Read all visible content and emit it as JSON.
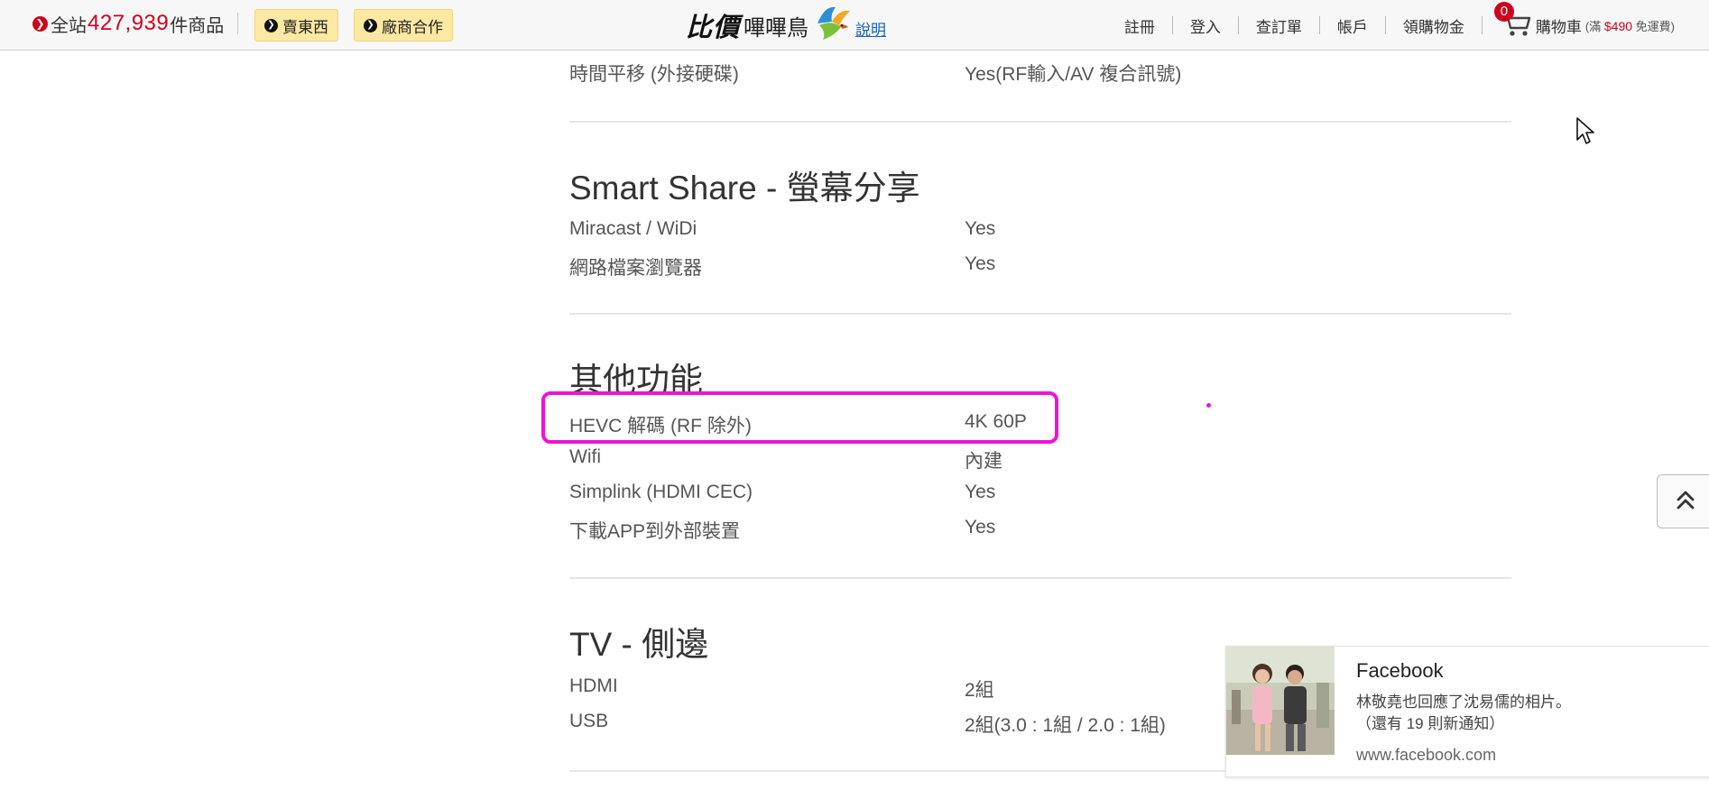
{
  "topbar": {
    "count_prefix": "全站",
    "count_number": "427,939",
    "count_suffix": "件商品",
    "sell_label": "賣東西",
    "partner_label": "廠商合作",
    "logo_main": "比價",
    "logo_sub": "嗶嗶鳥",
    "logo_help": "說明",
    "nav": [
      "註冊",
      "登入",
      "查訂單",
      "帳戶",
      "領購物金"
    ],
    "cart_count": "0",
    "cart_label": "購物車",
    "cart_note_prefix": "(滿",
    "cart_note_price": "$490",
    "cart_note_suffix": "免運費)"
  },
  "specs": {
    "top_row": {
      "key": "時間平移 (外接硬碟)",
      "value": "Yes(RF輸入/AV 複合訊號)"
    },
    "sections": [
      {
        "title": "Smart Share - 螢幕分享",
        "rows": [
          {
            "key": "Miracast / WiDi",
            "value": "Yes"
          },
          {
            "key": "網路檔案瀏覽器",
            "value": "Yes"
          }
        ]
      },
      {
        "title": "其他功能",
        "rows": [
          {
            "key": "HEVC 解碼 (RF 除外)",
            "value": "4K 60P"
          },
          {
            "key": "Wifi",
            "value": "內建"
          },
          {
            "key": "Simplink (HDMI CEC)",
            "value": "Yes"
          },
          {
            "key": "下載APP到外部裝置",
            "value": "Yes"
          }
        ]
      },
      {
        "title": "TV - 側邊",
        "rows": [
          {
            "key": "HDMI",
            "value": "2組"
          },
          {
            "key": "USB",
            "value": "2組(3.0 : 1組 / 2.0 : 1組)"
          }
        ]
      }
    ]
  },
  "notification": {
    "title": "Facebook",
    "line1": "林敬堯也回應了沈易儒的相片。",
    "line2": "（還有 19 則新通知）",
    "url": "www.facebook.com"
  },
  "colors": {
    "accent_red": "#d0021b",
    "highlight": "#ec14d5",
    "yellow_button": "#fde9a2"
  },
  "icons": [
    "arrow-right-circle-icon",
    "cart-icon",
    "bird-logo-icon",
    "double-chevron-up-icon",
    "mouse-cursor-icon"
  ]
}
